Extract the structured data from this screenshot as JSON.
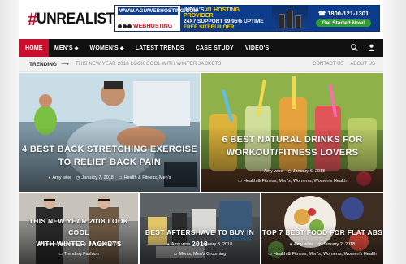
{
  "logo": {
    "hash": "#",
    "text": "UNREALISTIC"
  },
  "ad": {
    "url": "WWW.AGMWEBHOSTING.COM",
    "host_name": "WEBHOSTING",
    "line1_prefix": "INDIA'S ",
    "line1_highlight": "#1 HOSTING PROVIDER",
    "line2": "24X7 SUPPORT   99.95% UPTIME",
    "line3": "FREE SITEBUILDER",
    "phone": "1800-121-1301",
    "cta": "Get Started Now!"
  },
  "nav": {
    "items": [
      {
        "label": "HOME",
        "active": true,
        "caret": ""
      },
      {
        "label": "MEN'S",
        "active": false,
        "caret": "◆"
      },
      {
        "label": "WOMEN'S",
        "active": false,
        "caret": "◆"
      },
      {
        "label": "LATEST TRENDS",
        "active": false,
        "caret": ""
      },
      {
        "label": "CASE STUDY",
        "active": false,
        "caret": ""
      },
      {
        "label": "VIDEO'S",
        "active": false,
        "caret": ""
      }
    ],
    "search_icon": "search-icon",
    "user_icon": "user-icon"
  },
  "trending": {
    "label": "TRENDING",
    "arrow": "⟶",
    "headline": "THIS NEW YEAR 2018 LOOK COOL WITH WINTER JACKETS",
    "links": [
      "CONTACT US",
      "ABOUT US"
    ]
  },
  "cards": [
    {
      "title_lines": [
        "4 BEST BACK STRETCHING EXERCISE",
        "TO RELIEF BACK PAIN"
      ],
      "author": "Amy wise",
      "date": "January 7, 2018",
      "categories": "Health & Fitness, Men's"
    },
    {
      "title_lines": [
        "6 BEST NATURAL DRINKS FOR",
        "WORKOUT/FITNESS LOVERS"
      ],
      "author": "Amy wise",
      "date": "January 6, 2018",
      "categories": "Health & Fitness, Men's, Women's, Women's Health"
    },
    {
      "title_lines": [
        "THIS NEW YEAR 2018 LOOK COOL",
        "WITH WINTER JACKETS"
      ],
      "author": "Shweta Singhania",
      "date": "January 4, 2018",
      "categories": "Trending Fashion"
    },
    {
      "title_lines": [
        "BEST AFTERSHAVE TO BUY IN 2018"
      ],
      "author": "Amy wise",
      "date": "January 3, 2018",
      "categories": "Men's, Men's Grooming"
    },
    {
      "title_lines": [
        "TOP 7 BEST FOOD FOR FLAT ABS"
      ],
      "author": "Amy wise",
      "date": "January 2, 2018",
      "categories": "Health & Fitness, Men's, Women's, Women's Health"
    }
  ],
  "colors": {
    "accent": "#c8102e",
    "nav_bg": "#111111",
    "trend_bg": "#f1f1f1"
  }
}
